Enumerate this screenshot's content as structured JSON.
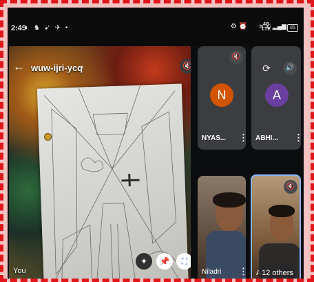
{
  "status_bar": {
    "time": "2:49",
    "left_icons": "◐ ♞ ➹ ✈ •",
    "right_icons": "⚙ ⏰",
    "network_top": "4G",
    "network_bottom": "LTE",
    "signal_icons": "≋ ✆ ▂▄▆",
    "battery": "85"
  },
  "meeting": {
    "title": "wuw-ijri-ycq",
    "self_label": "You"
  },
  "participants": [
    {
      "name": "NYAS...",
      "initial": "N",
      "avatar_color": "#d35400"
    },
    {
      "name": "ABHI...",
      "initial": "A",
      "avatar_color": "#6a3fa0"
    },
    {
      "name": "Niladri"
    },
    {
      "name": "A"
    }
  ],
  "others_count": "12 others",
  "icons": {
    "back": "←",
    "title_chevron": "›",
    "mic_off": "🔇",
    "effects": "✦",
    "pin": "📌",
    "fullscreen": "⛶",
    "rotate": "⟳",
    "volume": "🔊",
    "kebab": "⋮"
  },
  "colors": {
    "border_dashed": "#e0161a",
    "active_speaker_border": "#8ab4f8",
    "tile_bg": "#3c3d40"
  }
}
